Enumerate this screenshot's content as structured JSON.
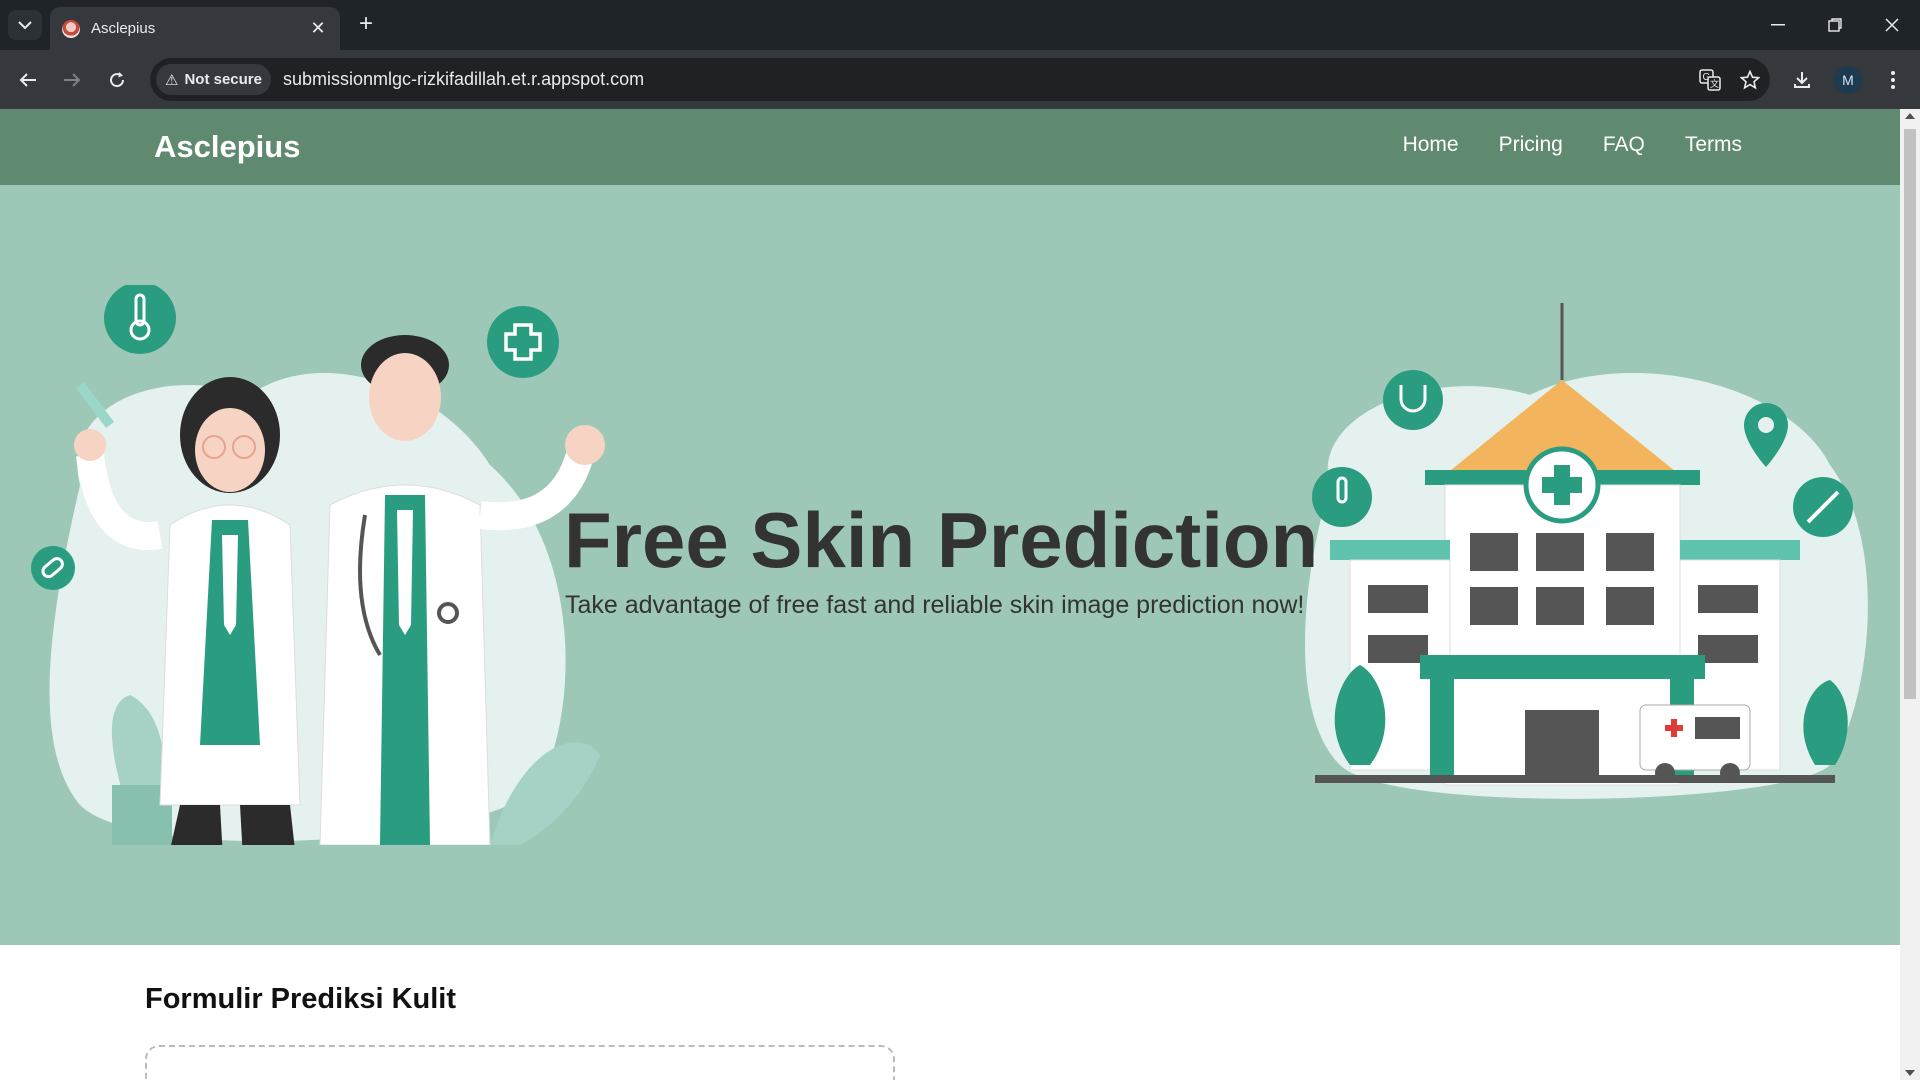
{
  "browser": {
    "tab_title": "Asclepius",
    "not_secure_label": "Not secure",
    "url": "submissionmlgc-rizkifadillah.et.r.appspot.com",
    "profile_initial": "M"
  },
  "page": {
    "brand": "Asclepius",
    "nav": [
      "Home",
      "Pricing",
      "FAQ",
      "Terms"
    ],
    "hero": {
      "title": "Free Skin Prediction",
      "subtitle": "Take advantage of free fast and reliable skin image prediction now!"
    },
    "form_title": "Formulir Prediksi Kulit"
  },
  "colors": {
    "navbar": "#5f8a70",
    "hero_bg": "#9dc8b8",
    "teal": "#2a9d80"
  }
}
